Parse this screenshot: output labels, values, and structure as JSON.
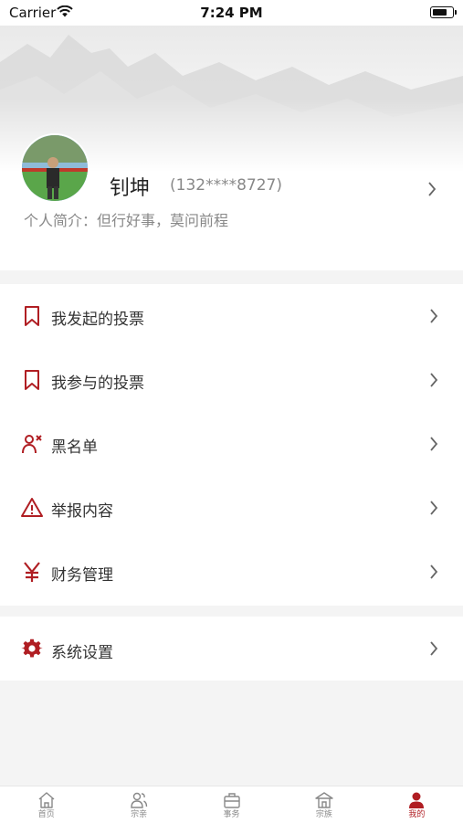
{
  "status_bar": {
    "carrier": "Carrier",
    "time": "7:24 PM"
  },
  "profile": {
    "name": "钊坤",
    "phone": "(132****8727)",
    "bio": "个人简介：但行好事，莫问前程"
  },
  "menu": {
    "items": [
      {
        "label": "我发起的投票",
        "icon": "bookmark-icon"
      },
      {
        "label": "我参与的投票",
        "icon": "bookmark-icon"
      },
      {
        "label": "黑名单",
        "icon": "user-block-icon"
      },
      {
        "label": "举报内容",
        "icon": "warning-icon"
      },
      {
        "label": "财务管理",
        "icon": "yen-icon"
      }
    ]
  },
  "settings": {
    "label": "系统设置",
    "icon": "gear-icon"
  },
  "tab_bar": {
    "tabs": [
      {
        "label": "首页",
        "icon": "home-icon",
        "active": false
      },
      {
        "label": "宗亲",
        "icon": "people-icon",
        "active": false
      },
      {
        "label": "事务",
        "icon": "briefcase-icon",
        "active": false
      },
      {
        "label": "宗族",
        "icon": "temple-icon",
        "active": false
      },
      {
        "label": "我的",
        "icon": "person-icon",
        "active": true
      }
    ]
  },
  "colors": {
    "accent": "#b01e23",
    "text": "#333333",
    "muted": "#888888",
    "background": "#f4f4f4"
  }
}
